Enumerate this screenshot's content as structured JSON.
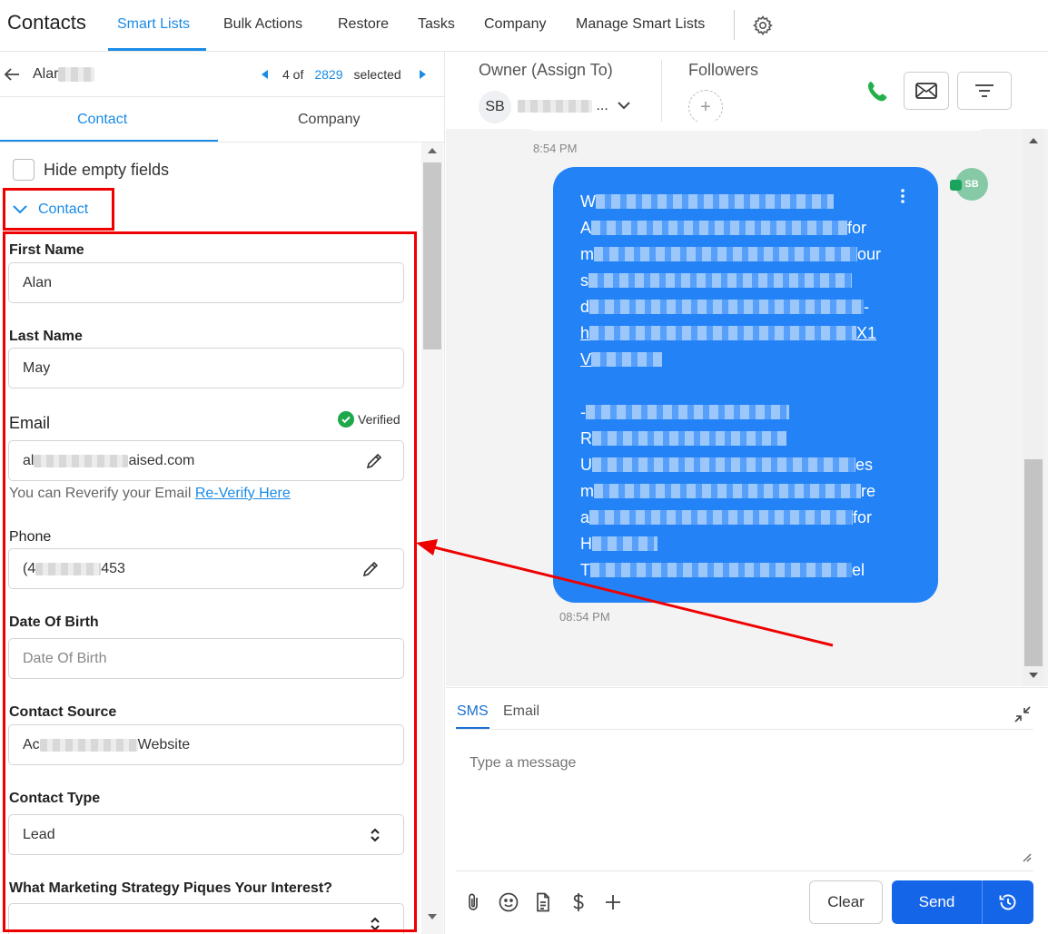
{
  "app": {
    "title": "Contacts"
  },
  "nav": {
    "tabs": [
      "Smart Lists",
      "Bulk Actions",
      "Restore",
      "Tasks",
      "Company",
      "Manage Smart Lists"
    ]
  },
  "record": {
    "name_visible": "Alar",
    "position": "4 of",
    "total": "2829",
    "selected": "selected"
  },
  "subtabs": [
    "Contact",
    "Company"
  ],
  "left": {
    "hide_empty_label": "Hide empty fields",
    "section_title": "Contact"
  },
  "fields": {
    "first_name": {
      "label": "First Name",
      "value": "Alan"
    },
    "last_name": {
      "label": "Last Name",
      "value": "May"
    },
    "email": {
      "label": "Email",
      "value_start": "al",
      "value_end": "aised.com",
      "verified_label": "Verified",
      "reverify_text": "You can Reverify your Email",
      "reverify_link": "Re-Verify Here"
    },
    "phone": {
      "label": "Phone",
      "value_start": "(4",
      "value_end": "453"
    },
    "dob": {
      "label": "Date Of Birth",
      "placeholder": "Date Of Birth"
    },
    "contact_source": {
      "label": "Contact Source",
      "value_start": "Ac",
      "value_end": "Website"
    },
    "contact_type": {
      "label": "Contact Type",
      "value": "Lead"
    },
    "marketing": {
      "label": "What Marketing Strategy Piques Your Interest?",
      "value": ""
    }
  },
  "header": {
    "owner_label": "Owner (Assign To)",
    "owner_initials": "SB",
    "owner_name_suffix": "...",
    "followers_label": "Followers",
    "add_follower": "+"
  },
  "conversation": {
    "time_prev": "8:54 PM",
    "time_msg": "08:54 PM",
    "avatar_initials": "SB",
    "lines": [
      {
        "start": "W",
        "end": ""
      },
      {
        "start": "A",
        "end": "for"
      },
      {
        "start": "m",
        "end": "our"
      },
      {
        "start": "s",
        "end": ""
      },
      {
        "start": "d",
        "end": "-"
      },
      {
        "start": "h",
        "end": "X1"
      },
      {
        "start": "V",
        "end": ""
      },
      {
        "start": "-",
        "end": ""
      },
      {
        "start": "R",
        "end": ""
      },
      {
        "start": "U",
        "end": "es"
      },
      {
        "start": "m",
        "end": "re"
      },
      {
        "start": "a",
        "end": "for"
      },
      {
        "start": "H",
        "end": ""
      },
      {
        "start": "T",
        "end": "el"
      }
    ]
  },
  "composer": {
    "tabs": [
      "SMS",
      "Email"
    ],
    "placeholder": "Type a message",
    "clear_label": "Clear",
    "send_label": "Send"
  },
  "colors": {
    "accent": "#1a8be6",
    "bubble": "#2383f6",
    "send": "#1565e9",
    "annotation": "#e00000",
    "phone": "#22b04b"
  }
}
